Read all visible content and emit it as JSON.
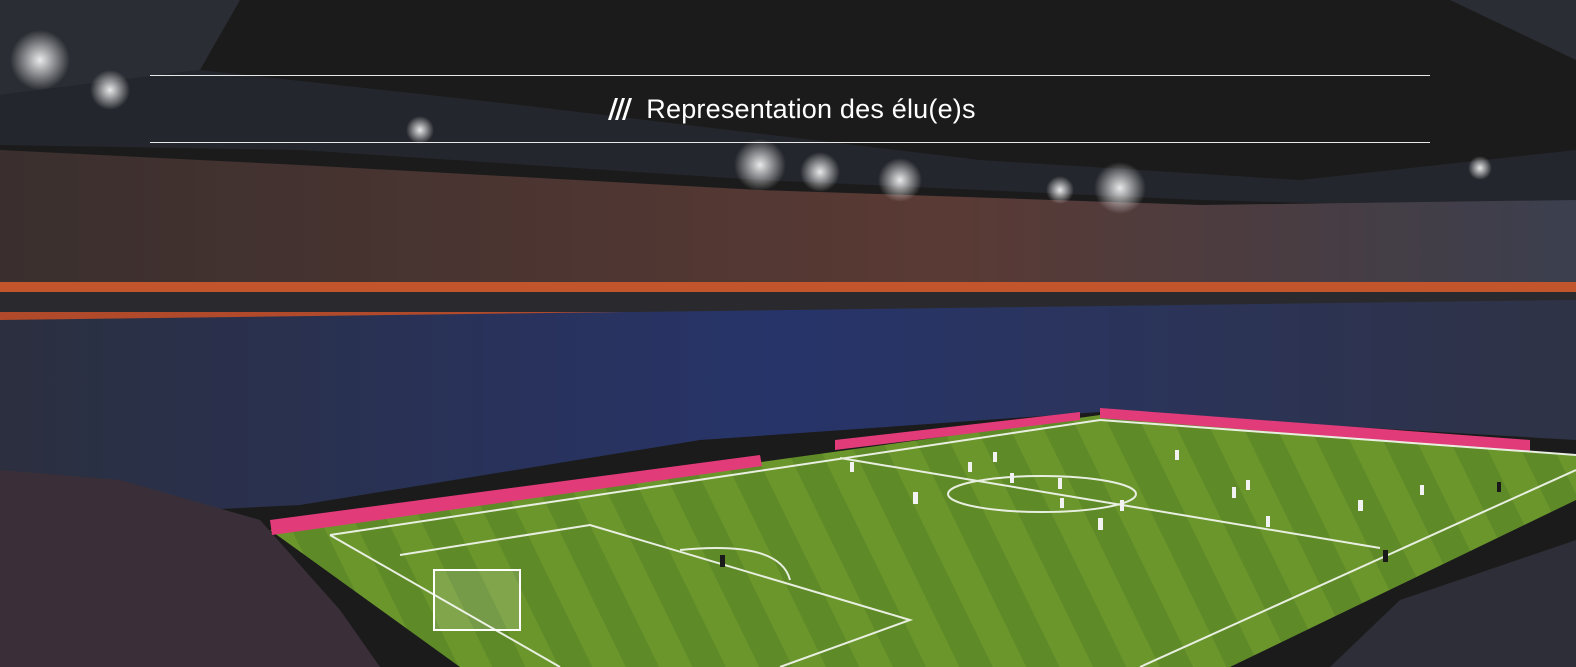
{
  "banner": {
    "title": "Representation des élu(e)s",
    "title_icon": "slash-stripes-icon"
  },
  "colors": {
    "sky": "#1b1b1b",
    "pitch_light": "#6f9a2e",
    "pitch_dark": "#5b8427",
    "ad_board": "#e23b7a",
    "tier_band": "#c2552c",
    "text": "#ffffff"
  }
}
